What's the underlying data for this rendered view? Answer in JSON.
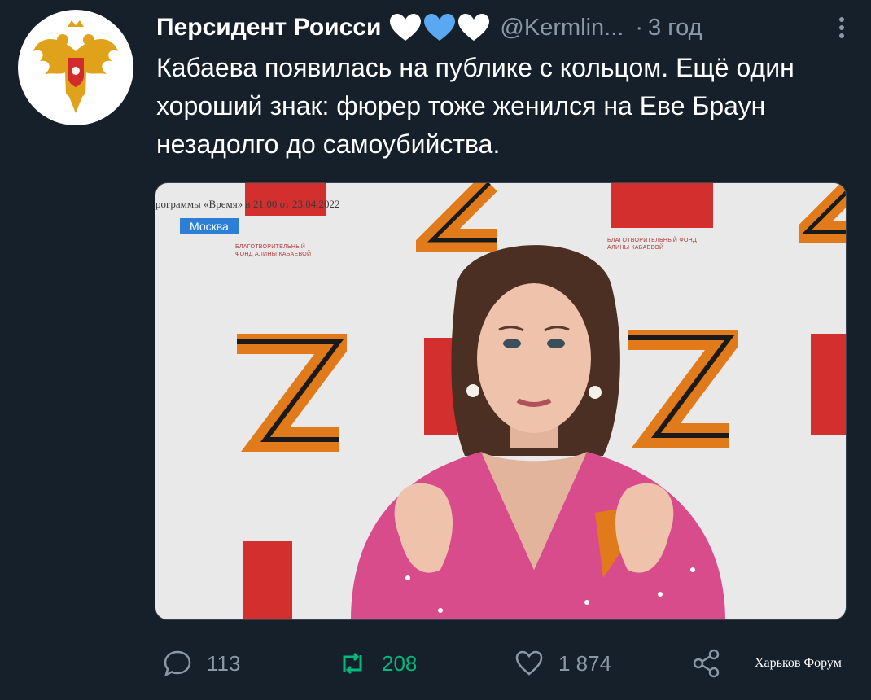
{
  "tweet": {
    "author": {
      "display_name": "Персидент Роисси",
      "handle": "@Kermlin...",
      "avatar_icon": "russian-coat-of-arms-icon",
      "hearts": [
        "#ffffff",
        "#5aa8f2",
        "#ffffff"
      ]
    },
    "time_separator": "·",
    "time": "3 год",
    "text": "Кабаева появилась на публике с кольцом. Ещё один хороший знак: фюрер тоже женился на Еве Браун незадолго до самоубийства.",
    "media": {
      "caption": "рограммы «Время» в 21:00 от 23.04.2022",
      "location_label": "Москва",
      "fund_label": "БЛАГОТВОРИТЕЛЬНЫЙ ФОНД АЛИНЫ КАБАЕВОЙ"
    },
    "actions": {
      "reply_count": "113",
      "retweet_count": "208",
      "like_count": "1 874",
      "retweet_color": "#00ba7c"
    }
  },
  "watermark": "Харьков Форум"
}
